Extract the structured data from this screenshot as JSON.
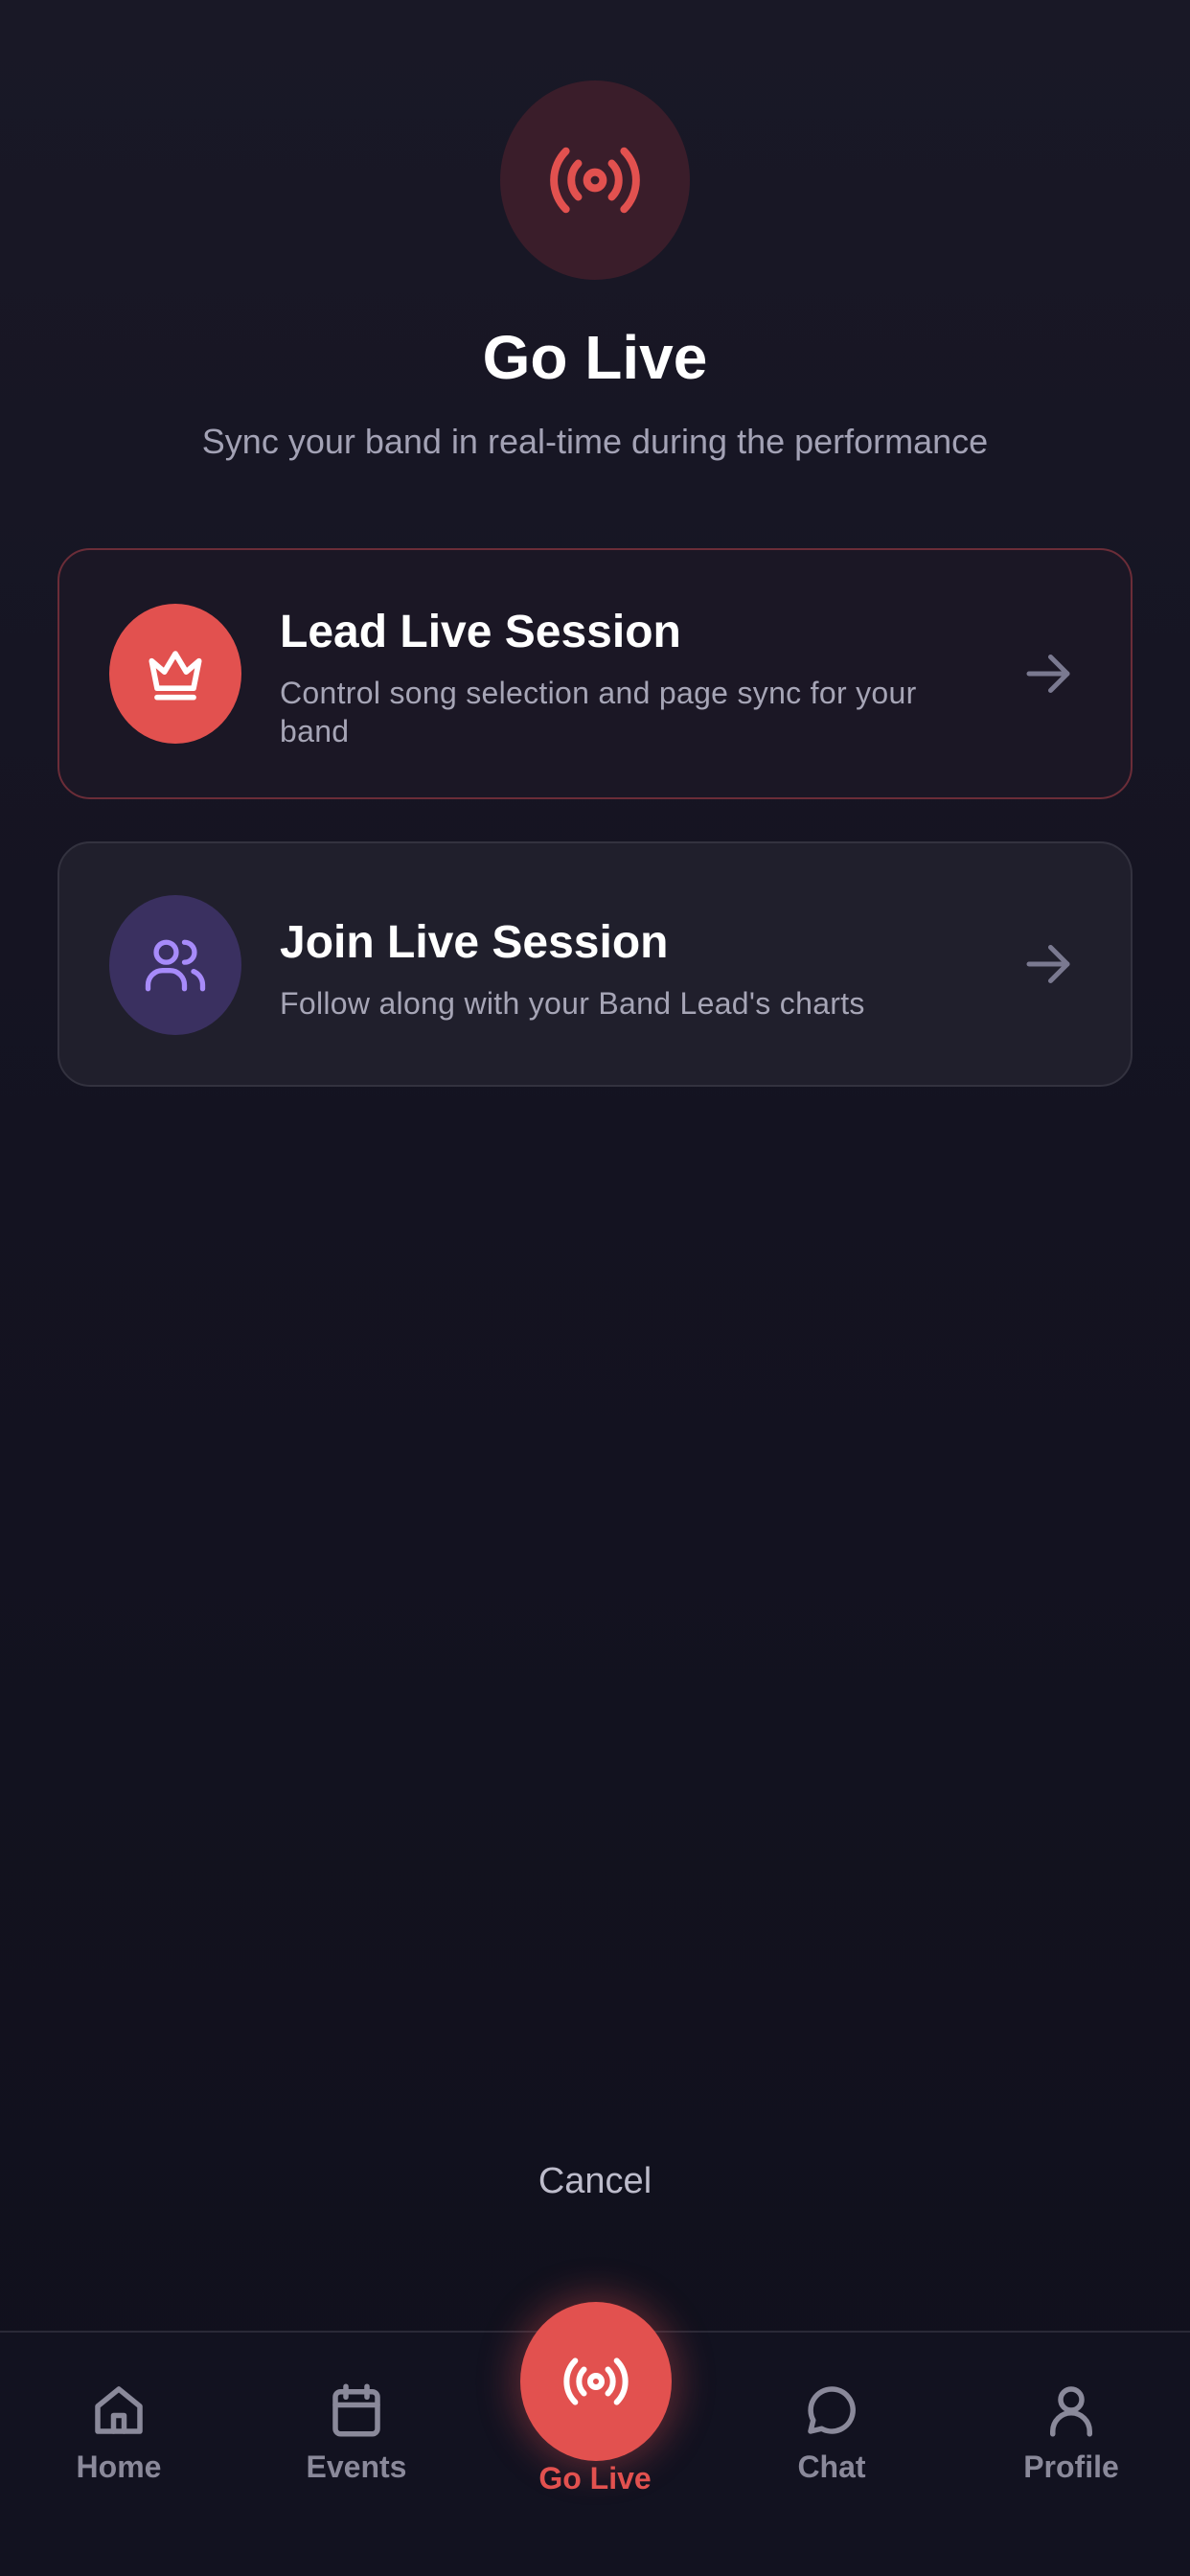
{
  "header": {
    "icon": "broadcast-icon",
    "title": "Go Live",
    "subtitle": "Sync your band in real-time during the performance"
  },
  "options": [
    {
      "icon": "crown-icon",
      "title": "Lead Live Session",
      "description": "Control song selection and page sync for your band",
      "accent": "#e2514f"
    },
    {
      "icon": "users-icon",
      "title": "Join Live Session",
      "description": "Follow along with your Band Lead's charts",
      "accent": "#a78bfa"
    }
  ],
  "cancel_label": "Cancel",
  "tabbar": {
    "items": [
      {
        "label": "Home",
        "icon": "home-icon"
      },
      {
        "label": "Events",
        "icon": "calendar-icon"
      },
      {
        "label": "Go Live",
        "icon": "broadcast-icon",
        "active": true
      },
      {
        "label": "Chat",
        "icon": "chat-bubble-icon"
      },
      {
        "label": "Profile",
        "icon": "user-icon"
      }
    ]
  },
  "colors": {
    "background": "#141321",
    "accent_red": "#e2514f",
    "accent_purple": "#a78bfa",
    "muted_text": "#a3a2b5"
  }
}
